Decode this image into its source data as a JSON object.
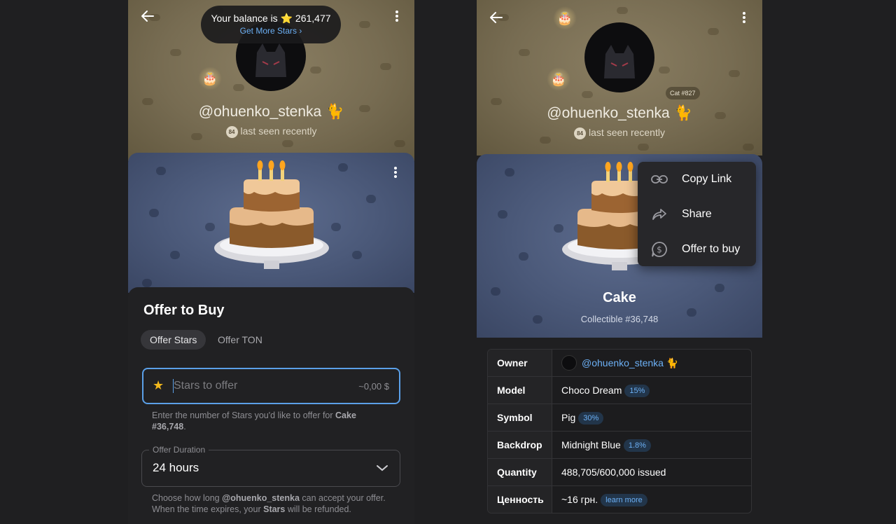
{
  "left": {
    "toast": {
      "balance_prefix": "Your balance is",
      "balance_star": "⭐",
      "balance_value": "261,477",
      "get_more": "Get More Stars ›"
    },
    "profile": {
      "username": "@ohuenko_stenka",
      "level": "84",
      "status": "last seen recently"
    },
    "sheet": {
      "title": "Offer to Buy",
      "tabs": [
        {
          "label": "Offer Stars",
          "active": true
        },
        {
          "label": "Offer TON",
          "active": false
        }
      ],
      "stars_input": {
        "placeholder": "Stars to offer",
        "value": "",
        "usd_estimate": "~0,00 $"
      },
      "stars_hint_prefix": "Enter the number of Stars you'd like to offer for ",
      "stars_hint_item": "Cake #36,748",
      "stars_hint_suffix": ".",
      "duration": {
        "label": "Offer Duration",
        "value": "24 hours"
      },
      "duration_hint_1": "Choose how long ",
      "duration_hint_user": "@ohuenko_stenka",
      "duration_hint_2": " can accept your offer. When the time expires, your ",
      "duration_hint_stars": "Stars",
      "duration_hint_3": " will be refunded."
    }
  },
  "right": {
    "profile": {
      "username": "@ohuenko_stenka",
      "level": "84",
      "status": "last seen recently",
      "badge": "Cat #827"
    },
    "gift": {
      "name": "Cake",
      "collectible": "Collectible #36,748"
    },
    "menu": [
      {
        "label": "Copy Link",
        "icon": "link-icon"
      },
      {
        "label": "Share",
        "icon": "share-icon"
      },
      {
        "label": "Offer to buy",
        "icon": "dollar-circle-icon"
      }
    ],
    "table": {
      "owner": {
        "key": "Owner",
        "value": "@ohuenko_stenka"
      },
      "model": {
        "key": "Model",
        "value": "Choco Dream",
        "pct": "15%"
      },
      "symbol": {
        "key": "Symbol",
        "value": "Pig",
        "pct": "30%"
      },
      "backdrop": {
        "key": "Backdrop",
        "value": "Midnight Blue",
        "pct": "1.8%"
      },
      "quantity": {
        "key": "Quantity",
        "value": "488,705/600,000 issued"
      },
      "value": {
        "key": "Ценность",
        "value": "~16 грн.",
        "link": "learn more"
      }
    }
  },
  "colors": {
    "accent": "#5ba0e8",
    "header_bg": "#776c52",
    "gift_bg": "#4a5878",
    "sheet_bg": "#212123"
  }
}
